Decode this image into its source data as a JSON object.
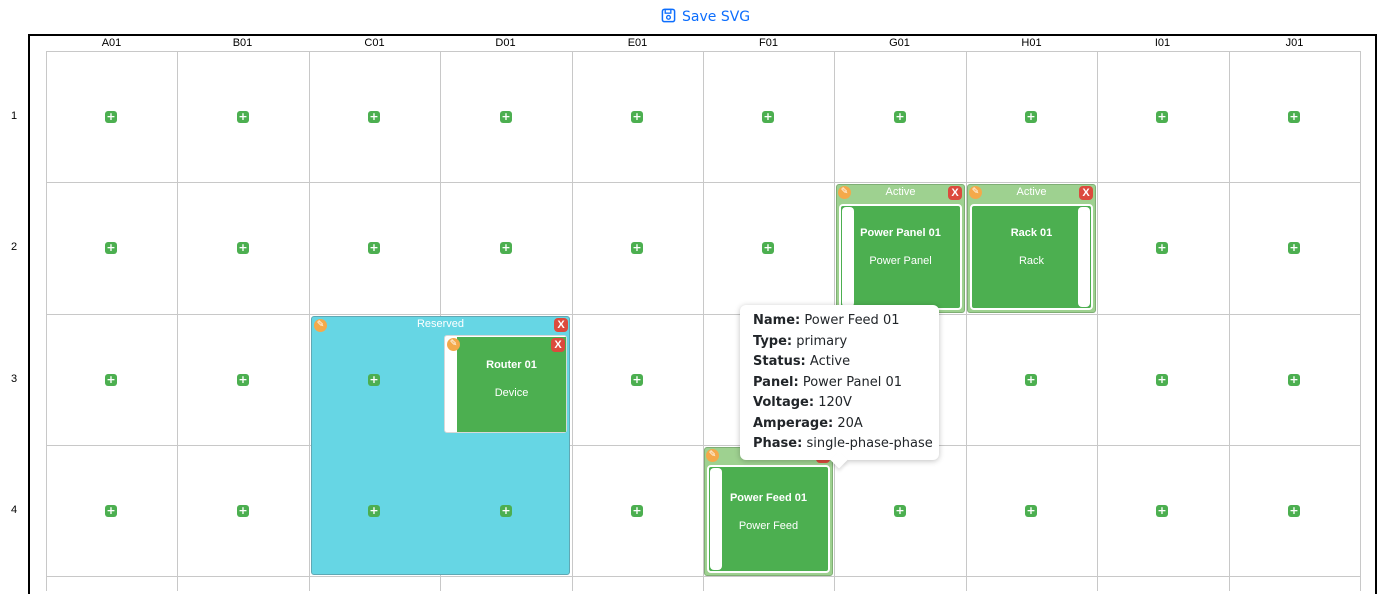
{
  "toolbar": {
    "save_label": "Save SVG",
    "save_icon": "floppy-disk-icon"
  },
  "grid": {
    "columns": [
      "A01",
      "B01",
      "C01",
      "D01",
      "E01",
      "F01",
      "G01",
      "H01",
      "I01",
      "J01"
    ],
    "rows": [
      "1",
      "2",
      "3",
      "4"
    ]
  },
  "reserved_block": {
    "label": "Reserved",
    "color": "#66d6e4"
  },
  "cards": {
    "power_panel": {
      "status": "Active",
      "name": "Power Panel 01",
      "type": "Power Panel"
    },
    "rack": {
      "status": "Active",
      "name": "Rack 01",
      "type": "Rack"
    },
    "router": {
      "name": "Router 01",
      "type": "Device"
    },
    "power_feed": {
      "name": "Power Feed 01",
      "type": "Power Feed"
    }
  },
  "tooltip": {
    "lines": [
      {
        "key": "Name:",
        "value": "Power Feed 01"
      },
      {
        "key": "Type:",
        "value": "primary"
      },
      {
        "key": "Status:",
        "value": "Active"
      },
      {
        "key": "Panel:",
        "value": "Power Panel 01"
      },
      {
        "key": "Voltage:",
        "value": "120V"
      },
      {
        "key": "Amperage:",
        "value": "20A"
      },
      {
        "key": "Phase:",
        "value": "single-phase-phase"
      }
    ]
  },
  "icons": {
    "add": "plus-icon",
    "edit": "pencil-icon",
    "close": "close-icon",
    "close_label": "X"
  },
  "colors": {
    "accent": "#4caf50",
    "edit": "#f4a94a",
    "close": "#dc4a3d",
    "link": "#0d6efd"
  }
}
